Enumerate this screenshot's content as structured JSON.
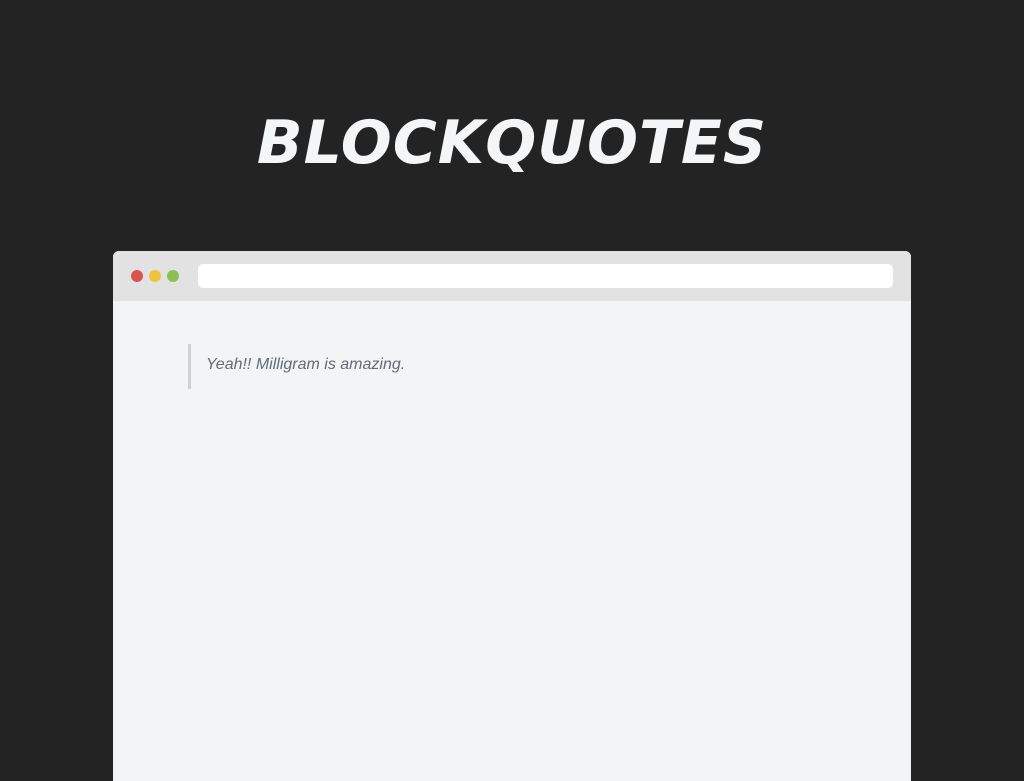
{
  "page": {
    "heading": "BLOCKQUOTES"
  },
  "window": {
    "controls": [
      {
        "name": "close",
        "color": "#d9534f"
      },
      {
        "name": "minimize",
        "color": "#f0c33c"
      },
      {
        "name": "maximize",
        "color": "#8cc152"
      }
    ],
    "address_bar": {
      "value": ""
    }
  },
  "content": {
    "blockquote": {
      "text": "Yeah!! Milligram is amazing."
    }
  },
  "colors": {
    "page_background": "#232323",
    "heading_text": "#f4f5f6",
    "window_background": "#f3f4f6",
    "titlebar_background": "#e2e2e2",
    "blockquote_border": "#d1d1d1",
    "blockquote_text": "#606c76"
  }
}
